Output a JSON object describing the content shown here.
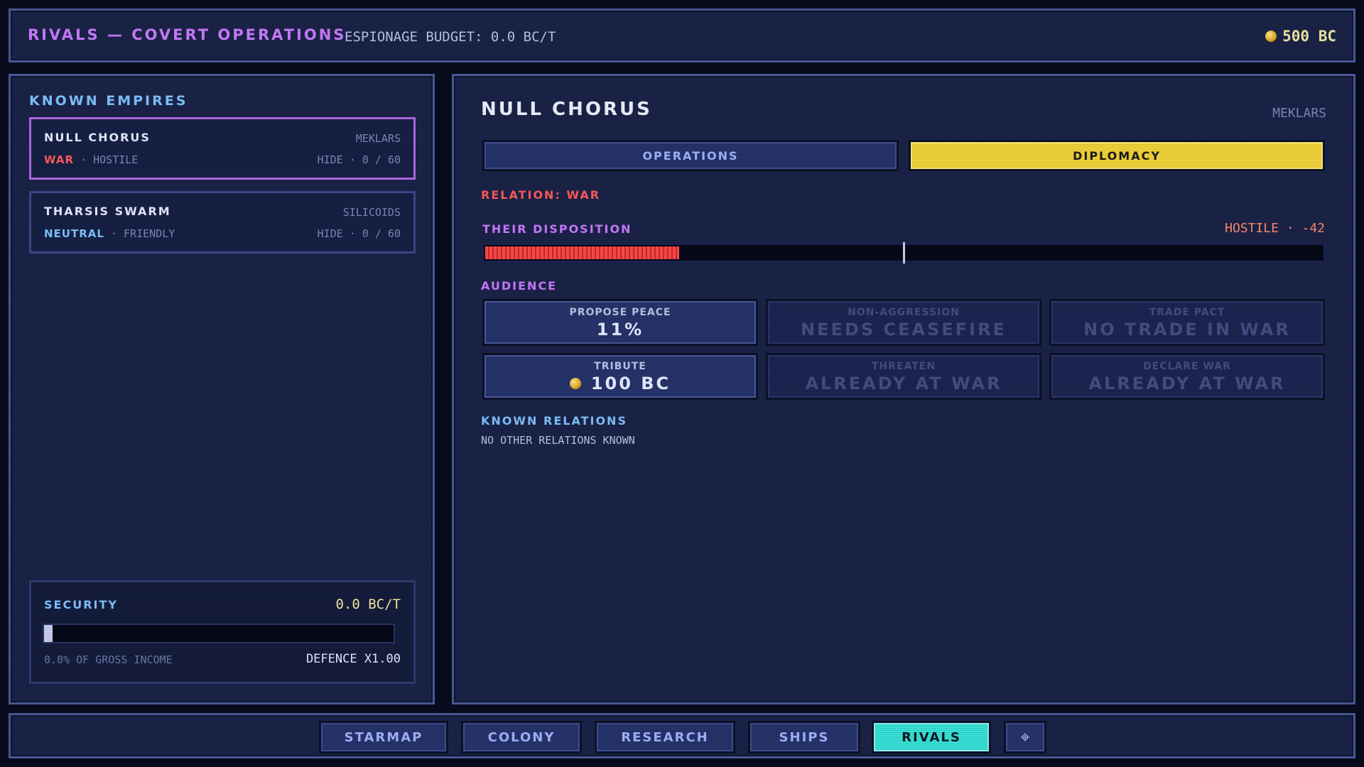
{
  "header": {
    "title": "RIVALS — COVERT OPERATIONS",
    "budget": "ESPIONAGE BUDGET: 0.0 BC/T",
    "credits": "500 BC"
  },
  "left": {
    "title": "KNOWN EMPIRES",
    "empires": [
      {
        "name": "NULL CHORUS",
        "race": "MEKLARS",
        "relation": "WAR",
        "disposition": "· HOSTILE",
        "hide": "HIDE · 0 / 60"
      },
      {
        "name": "THARSIS SWARM",
        "race": "SILICOIDS",
        "relation": "NEUTRAL",
        "disposition": "· FRIENDLY",
        "hide": "HIDE · 0 / 60"
      }
    ],
    "security": {
      "label": "SECURITY",
      "value": "0.0 BC/T",
      "percent_text": "0.0% OF GROSS INCOME",
      "defence": "DEFENCE X1.00",
      "level": 0.0
    }
  },
  "detail": {
    "empire_name": "NULL CHORUS",
    "race": "MEKLARS",
    "tabs": [
      "OPERATIONS",
      "DIPLOMACY"
    ],
    "active_tab": "DIPLOMACY",
    "relation": "RELATION: WAR",
    "disposition_label": "THEIR DISPOSITION",
    "disposition_value": "HOSTILE · -42",
    "disposition_score": -42,
    "audience_label": "AUDIENCE",
    "actions": [
      {
        "label": "PROPOSE PEACE",
        "value": "11%",
        "enabled": true
      },
      {
        "label": "NON-AGGRESSION",
        "value": "NEEDS CEASEFIRE",
        "enabled": false
      },
      {
        "label": "TRADE PACT",
        "value": "NO TRADE IN WAR",
        "enabled": false
      },
      {
        "label": "TRIBUTE",
        "value": "100 BC",
        "enabled": true
      },
      {
        "label": "THREATEN",
        "value": "ALREADY AT WAR",
        "enabled": false
      },
      {
        "label": "DECLARE WAR",
        "value": "ALREADY AT WAR",
        "enabled": false
      }
    ],
    "known_relations_label": "KNOWN RELATIONS",
    "known_relations_text": "NO OTHER RELATIONS KNOWN"
  },
  "nav": {
    "items": [
      "STARMAP",
      "COLONY",
      "RESEARCH",
      "SHIPS",
      "RIVALS"
    ],
    "active": "RIVALS",
    "extra_icon": "crosshair-icon"
  },
  "colors": {
    "accent_purple": "#c97bff",
    "accent_cyan": "#37e0d6",
    "war_red": "#ff5a5a",
    "diplomacy_yellow": "#f2d23a"
  }
}
